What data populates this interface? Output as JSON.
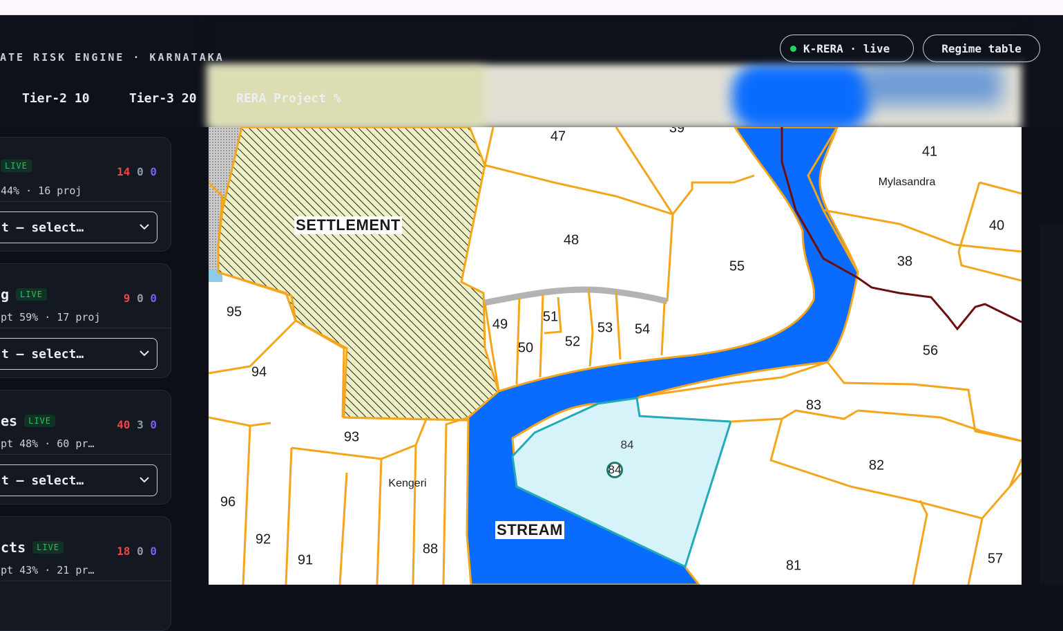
{
  "header": {
    "brand": "ATE RISK ENGINE · KARNATAKA",
    "live_pill": "K-RERA · live",
    "table_button": "Regime table",
    "tabs": [
      "Tier-2 10",
      "Tier-3 20",
      "RERA Project %"
    ]
  },
  "cards": [
    {
      "name": "",
      "live": "LIVE",
      "meta": " 44% · 16 proj",
      "counts": [
        "14",
        "0",
        "0"
      ],
      "select": "t — select…"
    },
    {
      "name": "g",
      "live": "LIVE",
      "meta": "pt 59% · 17 proj",
      "counts": [
        "9",
        "0",
        "0"
      ],
      "select": "t — select…"
    },
    {
      "name": "es",
      "live": "LIVE",
      "meta": "pt 48% · 60 pr…",
      "counts": [
        "40",
        "3",
        "0"
      ],
      "select": "t — select…"
    },
    {
      "name": "cts",
      "live": "LIVE",
      "meta": "pt 43% · 21 pr…",
      "counts": [
        "18",
        "0",
        "0"
      ],
      "select": ""
    }
  ],
  "map": {
    "regions": {
      "settlement": "SETTLEMENT",
      "stream": "STREAM"
    },
    "places": {
      "mylasandra": "Mylasandra",
      "kengeri": "Kengeri"
    },
    "highlighted_plot": "84",
    "marker": "84",
    "survey_numbers": {
      "n39": "39",
      "n47": "47",
      "n41": "41",
      "n40": "40",
      "n48": "48",
      "n55": "55",
      "n38": "38",
      "n95": "95",
      "n49": "49",
      "n51": "51",
      "n53": "53",
      "n54": "54",
      "n50": "50",
      "n52": "52",
      "n56": "56",
      "n94": "94",
      "n83": "83",
      "n93": "93",
      "n82": "82",
      "n96": "96",
      "n92": "92",
      "n91": "91",
      "n88": "88",
      "n81": "81",
      "n57": "57"
    },
    "colors": {
      "stream": "#0a6cff",
      "boundary": "#f4a51c",
      "highlight_fill": "#d5f3f8",
      "highlight_stroke": "#22aab8",
      "settlement_fill": "#eef0c6",
      "road": "#b3b3b3",
      "border_line": "#6b0e10"
    }
  }
}
